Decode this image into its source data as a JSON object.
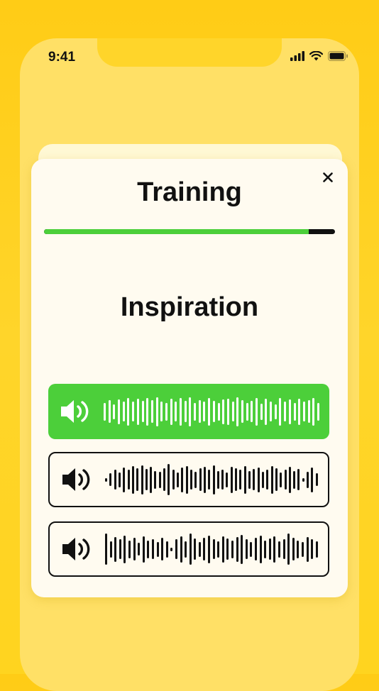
{
  "status_bar": {
    "time": "9:41"
  },
  "card": {
    "title": "Training",
    "progress": 0.91,
    "word": "Inspiration"
  },
  "options": [
    {
      "selected": true,
      "icon": "speaker-icon",
      "bars": [
        0.55,
        0.7,
        0.45,
        0.75,
        0.6,
        0.85,
        0.6,
        0.8,
        0.65,
        0.85,
        0.7,
        0.9,
        0.6,
        0.55,
        0.8,
        0.6,
        0.85,
        0.65,
        0.9,
        0.55,
        0.7,
        0.6,
        0.85,
        0.65,
        0.55,
        0.75,
        0.8,
        0.6,
        0.9,
        0.7,
        0.55,
        0.65,
        0.85,
        0.5,
        0.8,
        0.6,
        0.45,
        0.85,
        0.6,
        0.75,
        0.55,
        0.8,
        0.6,
        0.7,
        0.85,
        0.55
      ]
    },
    {
      "selected": false,
      "icon": "speaker-icon",
      "bars": [
        0.1,
        0.4,
        0.6,
        0.45,
        0.75,
        0.6,
        0.85,
        0.7,
        0.9,
        0.65,
        0.8,
        0.55,
        0.5,
        0.7,
        0.95,
        0.6,
        0.45,
        0.75,
        0.85,
        0.6,
        0.5,
        0.7,
        0.8,
        0.6,
        0.9,
        0.55,
        0.6,
        0.45,
        0.8,
        0.7,
        0.6,
        0.85,
        0.55,
        0.65,
        0.75,
        0.5,
        0.6,
        0.85,
        0.7,
        0.45,
        0.6,
        0.8,
        0.55,
        0.65,
        0.1,
        0.5,
        0.75,
        0.4
      ]
    },
    {
      "selected": false,
      "icon": "speaker-icon",
      "bars": [
        0.95,
        0.5,
        0.75,
        0.6,
        0.85,
        0.55,
        0.7,
        0.4,
        0.8,
        0.55,
        0.6,
        0.45,
        0.7,
        0.5,
        0.1,
        0.6,
        0.8,
        0.5,
        0.95,
        0.65,
        0.45,
        0.7,
        0.85,
        0.6,
        0.5,
        0.8,
        0.65,
        0.55,
        0.75,
        0.9,
        0.6,
        0.45,
        0.7,
        0.85,
        0.55,
        0.65,
        0.8,
        0.5,
        0.6,
        0.95,
        0.7,
        0.55,
        0.45,
        0.75,
        0.6,
        0.5
      ]
    }
  ],
  "colors": {
    "accent": "#4ccf3a",
    "ink": "#111111",
    "card": "#fffbf0",
    "background": "#ffcc16"
  }
}
